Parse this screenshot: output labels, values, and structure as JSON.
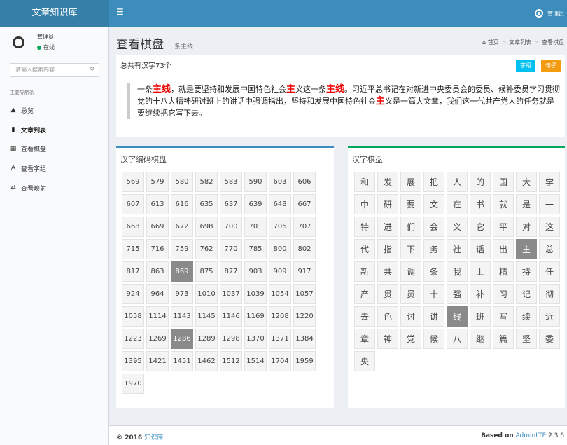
{
  "app": {
    "logo": "文章知识库",
    "user_short": "管理员"
  },
  "sidebar": {
    "user_name": "管理员",
    "status": "在线",
    "search_placeholder": "请输入搜索内容",
    "nav_header": "主要导航条",
    "items": [
      {
        "label": "总览",
        "icon": "dashboard-icon"
      },
      {
        "label": "文章列表",
        "icon": "document-icon"
      },
      {
        "label": "查看棋盘",
        "icon": "grid-icon"
      },
      {
        "label": "查看字组",
        "icon": "font-icon"
      },
      {
        "label": "查看映射",
        "icon": "shuffle-icon"
      }
    ]
  },
  "page": {
    "title": "查看棋盘",
    "subtitle": "一条主线"
  },
  "breadcrumb": [
    "首页",
    "文章列表",
    "查看棋盘"
  ],
  "summary": {
    "count_text": "总共有汉字73个",
    "btn_zizu": "字组",
    "btn_juzi": "句子",
    "quote_parts": [
      {
        "t": "一条",
        "h": false
      },
      {
        "t": "主线",
        "h": true
      },
      {
        "t": "，就是要坚持和发展中国特色社会",
        "h": false
      },
      {
        "t": "主",
        "h": true
      },
      {
        "t": "义这一条",
        "h": false
      },
      {
        "t": "主线",
        "h": true
      },
      {
        "t": "。习近平总书记在对新进中央委员会的委员、候补委员学习贯彻党的十八大精神研讨班上的讲话中强调指出，坚持和发展中国特色社会",
        "h": false
      },
      {
        "t": "主",
        "h": true
      },
      {
        "t": "义是一篇大文章，我们这一代共产党人的任务就是要继续把它写下去。",
        "h": false
      }
    ]
  },
  "board_codes": {
    "title": "汉字编码棋盘",
    "cells": [
      "569",
      "579",
      "580",
      "582",
      "583",
      "590",
      "603",
      "606",
      "607",
      "613",
      "616",
      "635",
      "637",
      "639",
      "648",
      "667",
      "668",
      "669",
      "672",
      "698",
      "700",
      "701",
      "706",
      "707",
      "715",
      "716",
      "759",
      "762",
      "770",
      "785",
      "800",
      "802",
      "817",
      "863",
      "869",
      "875",
      "877",
      "903",
      "909",
      "917",
      "924",
      "964",
      "973",
      "1010",
      "1037",
      "1039",
      "1054",
      "1057",
      "1058",
      "1114",
      "1143",
      "1145",
      "1146",
      "1169",
      "1208",
      "1220",
      "1223",
      "1269",
      "1286",
      "1289",
      "1298",
      "1370",
      "1371",
      "1384",
      "1395",
      "1421",
      "1451",
      "1462",
      "1512",
      "1514",
      "1704",
      "1959",
      "1970"
    ],
    "selected": [
      "869",
      "1286"
    ]
  },
  "board_chars": {
    "title": "汉字棋盘",
    "cells": [
      "和",
      "发",
      "展",
      "把",
      "人",
      "的",
      "国",
      "大",
      "学",
      "中",
      "研",
      "要",
      "文",
      "在",
      "书",
      "就",
      "是",
      "一",
      "特",
      "进",
      "们",
      "会",
      "义",
      "它",
      "平",
      "对",
      "这",
      "代",
      "指",
      "下",
      "务",
      "社",
      "话",
      "出",
      "主",
      "总",
      "新",
      "共",
      "调",
      "条",
      "我",
      "上",
      "精",
      "持",
      "任",
      "产",
      "贯",
      "员",
      "十",
      "强",
      "补",
      "习",
      "记",
      "彻",
      "去",
      "色",
      "讨",
      "讲",
      "线",
      "班",
      "写",
      "续",
      "近",
      "章",
      "神",
      "党",
      "候",
      "八",
      "继",
      "篇",
      "坚",
      "委",
      "央"
    ],
    "selected": [
      "主",
      "线"
    ]
  },
  "footer": {
    "copyright": "© 2016",
    "site": "知识库",
    "based_on": "Based on",
    "brand": "AdminLTE",
    "version": "2.3.6"
  },
  "colors": {
    "topbar": "#3c8dbc",
    "logo_bg": "#367fa9",
    "highlight": "#ee0000",
    "btn_zizu": "#00c0ef",
    "btn_juzi": "#f39c12",
    "selected_cell": "#8a8a8a"
  }
}
